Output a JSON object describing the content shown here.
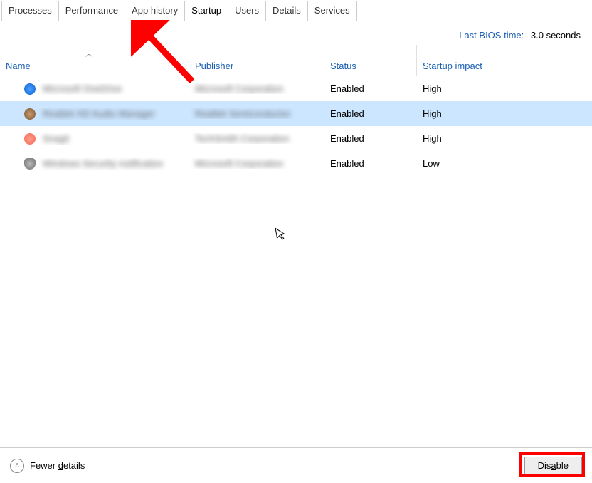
{
  "tabs": [
    "Processes",
    "Performance",
    "App history",
    "Startup",
    "Users",
    "Details",
    "Services"
  ],
  "active_tab_index": 3,
  "bios": {
    "label": "Last BIOS time:",
    "value": "3.0 seconds"
  },
  "columns": {
    "name": "Name",
    "publisher": "Publisher",
    "status": "Status",
    "impact": "Startup impact"
  },
  "rows": [
    {
      "icon": "ic-blue",
      "name": "Microsoft OneDrive",
      "publisher": "Microsoft Corporation",
      "status": "Enabled",
      "impact": "High",
      "selected": false
    },
    {
      "icon": "ic-brown",
      "name": "Realtek HD Audio Manager",
      "publisher": "Realtek Semiconductor",
      "status": "Enabled",
      "impact": "High",
      "selected": true
    },
    {
      "icon": "ic-red",
      "name": "Snagit",
      "publisher": "TechSmith Corporation",
      "status": "Enabled",
      "impact": "High",
      "selected": false
    },
    {
      "icon": "ic-shield",
      "name": "Windows Security notification",
      "publisher": "Microsoft Corporation",
      "status": "Enabled",
      "impact": "Low",
      "selected": false
    }
  ],
  "footer": {
    "fewer_details": "Fewer details",
    "disable": "Disable"
  },
  "annotations": {
    "arrow_target": "Startup tab",
    "highlight_target": "Disable button"
  }
}
